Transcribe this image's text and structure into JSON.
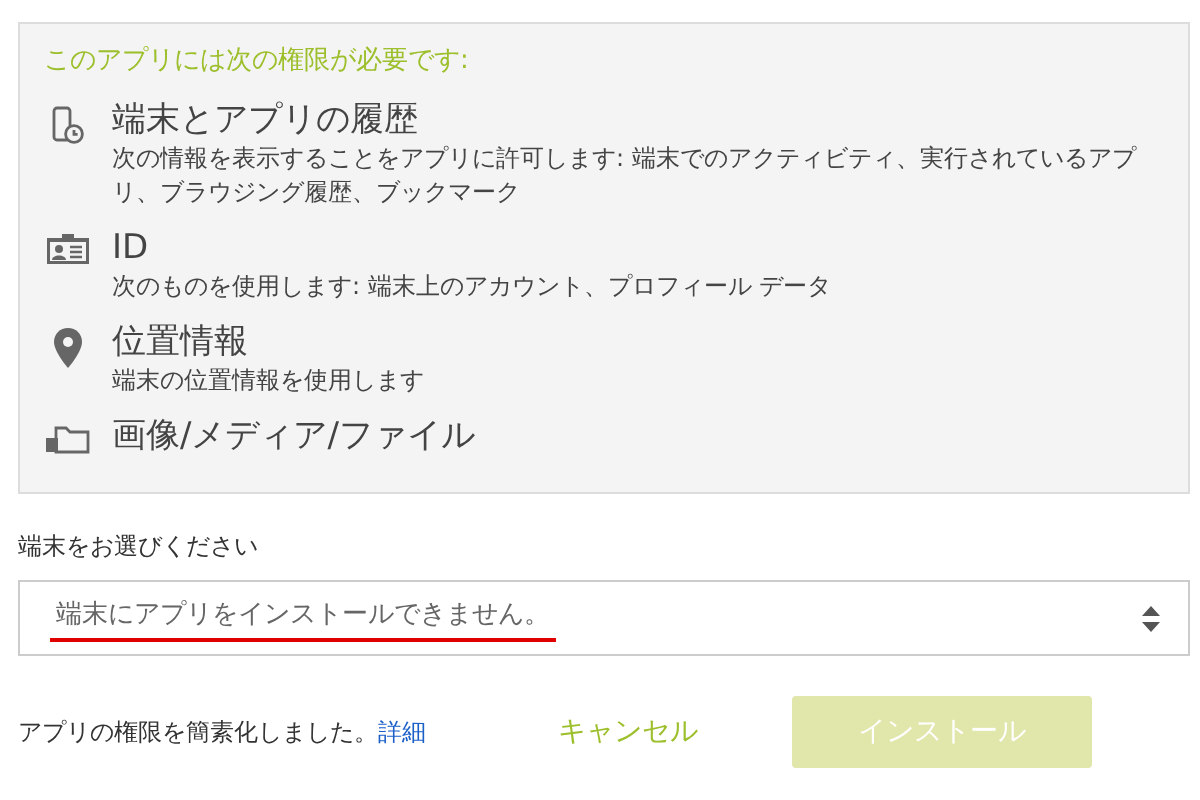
{
  "permissions_panel": {
    "heading": "このアプリには次の権限が必要です:",
    "items": [
      {
        "kind": "history",
        "title": "端末とアプリの履歴",
        "description": "次の情報を表示することをアプリに許可します: 端末でのアクティビティ、実行されているアプリ、ブラウジング履歴、ブックマーク"
      },
      {
        "kind": "id",
        "title": "ID",
        "description": "次のものを使用します: 端末上のアカウント、プロフィール データ"
      },
      {
        "kind": "location",
        "title": "位置情報",
        "description": "端末の位置情報を使用します"
      },
      {
        "kind": "media",
        "title": "画像/メディア/ファイル"
      }
    ]
  },
  "device_select": {
    "label": "端末をお選びください",
    "value": "端末にアプリをインストールできません。",
    "underlined": true
  },
  "footer": {
    "note": "アプリの権限を簡素化しました。",
    "link": "詳細",
    "cancel": "キャンセル",
    "install": {
      "label": "インストール",
      "disabled": true
    }
  }
}
